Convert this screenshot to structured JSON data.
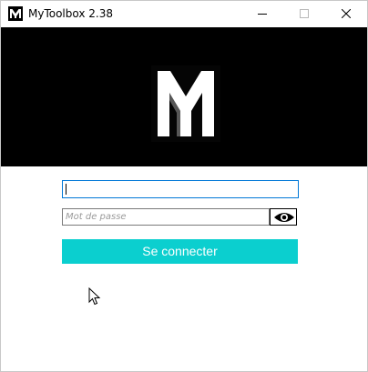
{
  "window": {
    "title": "MyToolbox 2.38",
    "icon": "m-logo-icon",
    "controls": [
      "minimize-icon",
      "maximize-icon",
      "close-icon"
    ]
  },
  "banner": {
    "logo": "m-logo",
    "background": "#000000"
  },
  "login": {
    "username_value": "",
    "password_placeholder": "Mot de passe",
    "show_password_icon": "eye-icon",
    "submit_label": "Se connecter",
    "accent_color": "#0bcfcf",
    "focus_color": "#0078d7"
  }
}
